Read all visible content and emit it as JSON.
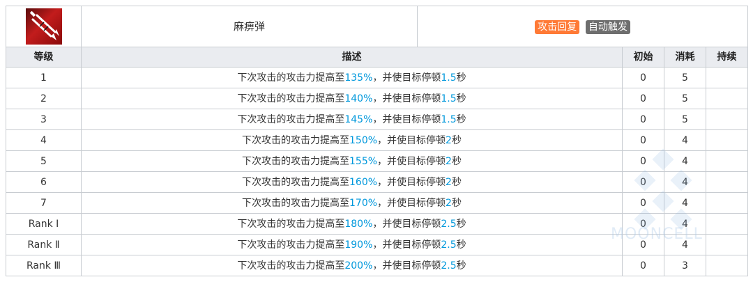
{
  "skill": {
    "name": "麻痹弹",
    "tags": [
      "攻击回复",
      "自动触发"
    ]
  },
  "columns": [
    "等级",
    "描述",
    "初始",
    "消耗",
    "持续"
  ],
  "rows": [
    {
      "level": "1",
      "desc": [
        "下次攻击的攻击力提高至",
        "135%",
        "，并使目标停顿",
        "1.5",
        "秒"
      ],
      "initial": "0",
      "cost": "5",
      "duration": ""
    },
    {
      "level": "2",
      "desc": [
        "下次攻击的攻击力提高至",
        "140%",
        "，并使目标停顿",
        "1.5",
        "秒"
      ],
      "initial": "0",
      "cost": "5",
      "duration": ""
    },
    {
      "level": "3",
      "desc": [
        "下次攻击的攻击力提高至",
        "145%",
        "，并使目标停顿",
        "1.5",
        "秒"
      ],
      "initial": "0",
      "cost": "5",
      "duration": ""
    },
    {
      "level": "4",
      "desc": [
        "下次攻击的攻击力提高至",
        "150%",
        "，并使目标停顿",
        "2",
        "秒"
      ],
      "initial": "0",
      "cost": "4",
      "duration": ""
    },
    {
      "level": "5",
      "desc": [
        "下次攻击的攻击力提高至",
        "155%",
        "，并使目标停顿",
        "2",
        "秒"
      ],
      "initial": "0",
      "cost": "4",
      "duration": ""
    },
    {
      "level": "6",
      "desc": [
        "下次攻击的攻击力提高至",
        "160%",
        "，并使目标停顿",
        "2",
        "秒"
      ],
      "initial": "0",
      "cost": "4",
      "duration": ""
    },
    {
      "level": "7",
      "desc": [
        "下次攻击的攻击力提高至",
        "170%",
        "，并使目标停顿",
        "2",
        "秒"
      ],
      "initial": "0",
      "cost": "4",
      "duration": ""
    },
    {
      "level": "Rank Ⅰ",
      "desc": [
        "下次攻击的攻击力提高至",
        "180%",
        "，并使目标停顿",
        "2.5",
        "秒"
      ],
      "initial": "0",
      "cost": "4",
      "duration": ""
    },
    {
      "level": "Rank Ⅱ",
      "desc": [
        "下次攻击的攻击力提高至",
        "190%",
        "，并使目标停顿",
        "2.5",
        "秒"
      ],
      "initial": "0",
      "cost": "4",
      "duration": ""
    },
    {
      "level": "Rank Ⅲ",
      "desc": [
        "下次攻击的攻击力提高至",
        "200%",
        "，并使目标停顿",
        "2.5",
        "秒"
      ],
      "initial": "0",
      "cost": "3",
      "duration": ""
    }
  ],
  "watermark": "MOONCELL",
  "colors": {
    "highlight": "#0098dc",
    "tag_auto_recovery": "#ff7a36",
    "tag_trigger": "#6e6e6e",
    "header_bg": "#eaecf0",
    "border": "#c8ccd1"
  },
  "icons": {
    "skill": "tranquilizer-darts-icon"
  }
}
